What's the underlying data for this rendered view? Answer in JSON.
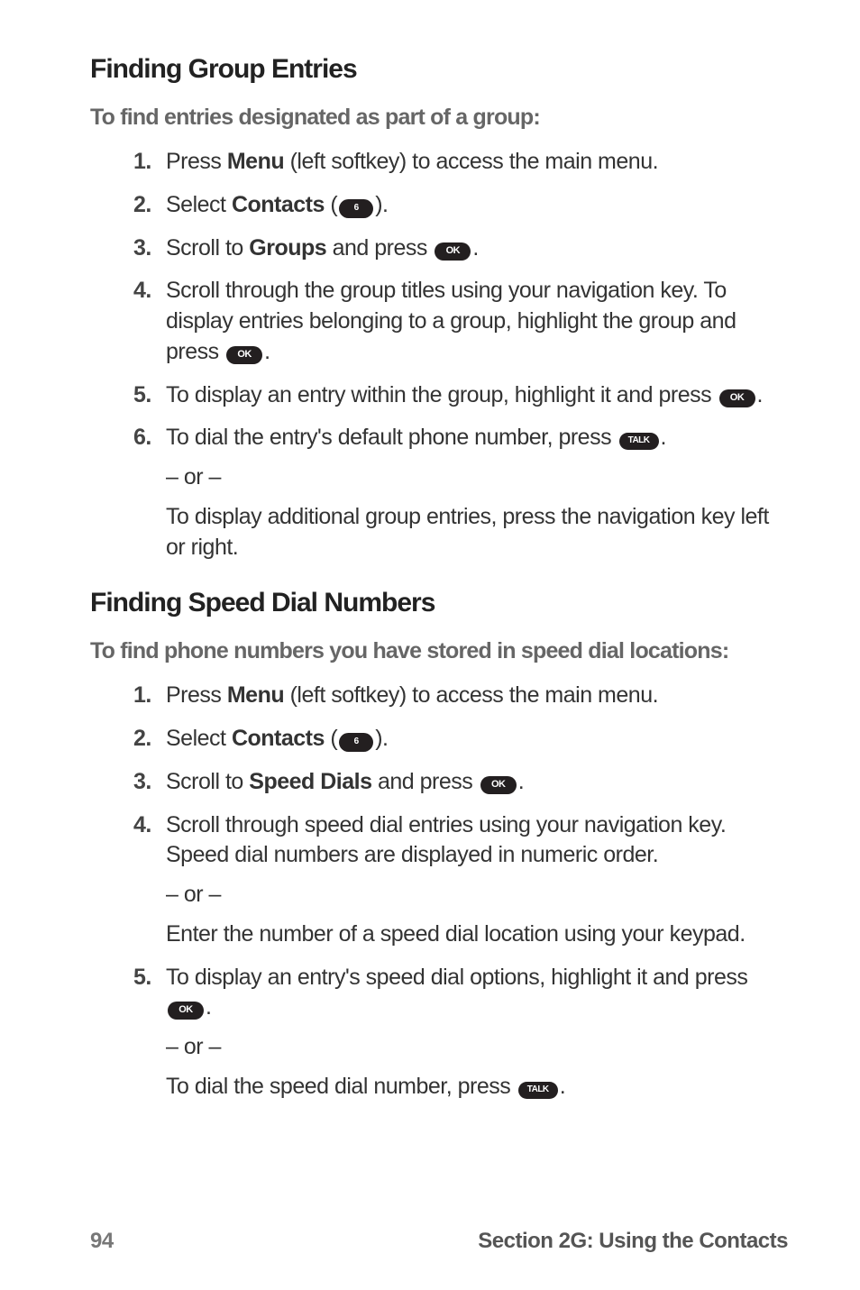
{
  "section1": {
    "heading": "Finding Group Entries",
    "subheading": "To find entries designated as part of a group:",
    "steps": [
      {
        "num": "1.",
        "pre": "Press ",
        "bold": "Menu",
        "post": " (left softkey) to access the main menu."
      },
      {
        "num": "2.",
        "pre": "Select ",
        "bold": "Contacts",
        "post_open": " (",
        "key_label": "6",
        "post_close": ")."
      },
      {
        "num": "3.",
        "pre": "Scroll to ",
        "bold": "Groups",
        "post_open": " and press ",
        "key_label": "OK",
        "post_close": "."
      },
      {
        "num": "4.",
        "text": "Scroll through the group titles using your navigation key. To display entries belonging to a group, highlight the group and press ",
        "key_label": "OK",
        "post_close": "."
      },
      {
        "num": "5.",
        "text": "To display an entry within the group, highlight it and press ",
        "key_label": "OK",
        "post_close": "."
      },
      {
        "num": "6.",
        "text": "To dial the entry's default phone number, press ",
        "key_label": "TALK",
        "post_close": ".",
        "or": "– or –",
        "extra": "To display additional group entries, press the navigation key left or right."
      }
    ]
  },
  "section2": {
    "heading": "Finding Speed Dial Numbers",
    "subheading": "To find phone numbers you have stored in speed dial locations:",
    "steps": [
      {
        "num": "1.",
        "pre": "Press ",
        "bold": "Menu",
        "post": " (left softkey) to access the main menu."
      },
      {
        "num": "2.",
        "pre": "Select ",
        "bold": "Contacts",
        "post_open": " (",
        "key_label": "6",
        "post_close": ")."
      },
      {
        "num": "3.",
        "pre": "Scroll to ",
        "bold": "Speed Dials",
        "post_open": " and press ",
        "key_label": "OK",
        "post_close": "."
      },
      {
        "num": "4.",
        "text": "Scroll through speed dial entries using your navigation key. Speed dial numbers are displayed in numeric order.",
        "or": "– or –",
        "extra": "Enter the number of a speed dial location using your keypad."
      },
      {
        "num": "5.",
        "text": "To display an entry's speed dial options, highlight it and press ",
        "key_label": "OK",
        "post_close": ".",
        "or": "– or –",
        "extra_pre": "To dial the speed dial number, press ",
        "extra_key": "TALK",
        "extra_post": "."
      }
    ]
  },
  "footer": {
    "page": "94",
    "section": "Section 2G: Using the Contacts"
  }
}
